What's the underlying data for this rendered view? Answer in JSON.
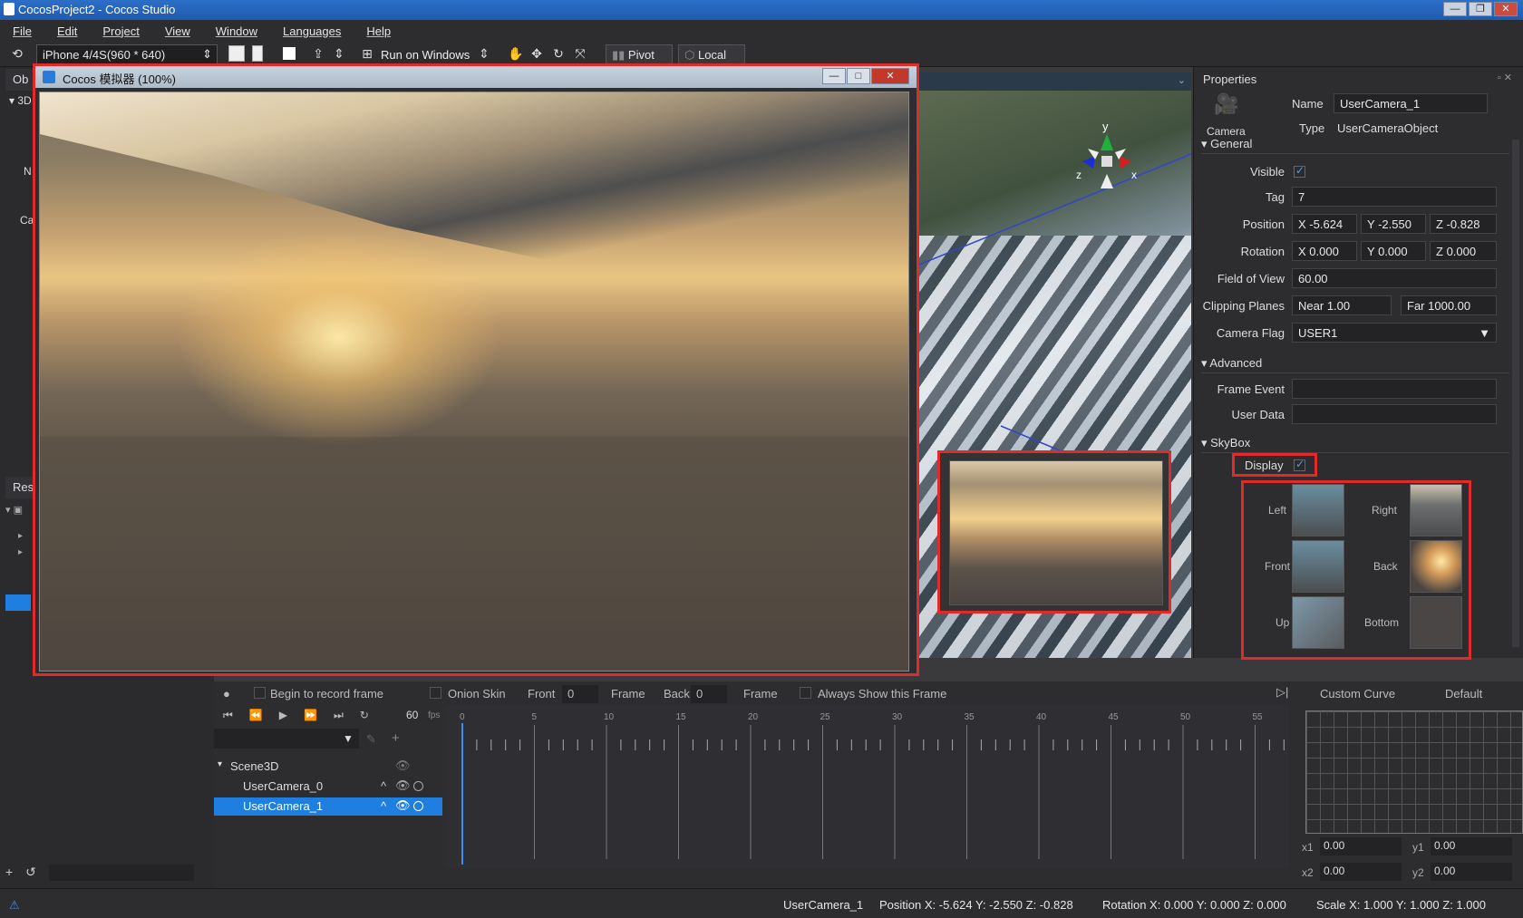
{
  "window": {
    "title": "CocosProject2 - Cocos Studio",
    "controls": [
      "—",
      "❐",
      "✕"
    ]
  },
  "menu": [
    "File",
    "Edit",
    "Project",
    "View",
    "Window",
    "Languages",
    "Help"
  ],
  "toolbar": {
    "device": "iPhone 4/4S(960 * 640)",
    "run_target": "Run on Windows",
    "pivot": "Pivot",
    "local": "Local"
  },
  "left": {
    "panel1_tab": "Ob",
    "tree_item": "3D",
    "n_label": "N",
    "ca_label": "Ca",
    "panel2_tab": "Res"
  },
  "simulator": {
    "title": "Cocos 模拟器 (100%)",
    "controls": [
      "—",
      "□",
      "✕"
    ]
  },
  "gizmo": {
    "y": "y",
    "x": "x",
    "z": "z"
  },
  "properties": {
    "header": "Properties",
    "icon_label": "Camera",
    "name_label": "Name",
    "name_value": "UserCamera_1",
    "type_label": "Type",
    "type_value": "UserCameraObject",
    "general": "General",
    "visible": "Visible",
    "tag_label": "Tag",
    "tag_value": "7",
    "position_label": "Position",
    "pos_x": "-5.624",
    "pos_y": "-2.550",
    "pos_z": "-0.828",
    "rotation_label": "Rotation",
    "rot_x": "0.000",
    "rot_y": "0.000",
    "rot_z": "0.000",
    "fov_label": "Field of View",
    "fov_value": "60.00",
    "clip_label": "Clipping Planes",
    "near_label": "Near",
    "near_value": "1.00",
    "far_label": "Far",
    "far_value": "1000.00",
    "flag_label": "Camera Flag",
    "flag_value": "USER1",
    "advanced": "Advanced",
    "frame_event": "Frame Event",
    "user_data": "User Data",
    "skybox": "SkyBox",
    "display": "Display",
    "faces": {
      "left": "Left",
      "right": "Right",
      "front": "Front",
      "back": "Back",
      "up": "Up",
      "bottom": "Bottom"
    },
    "axis_x": "X",
    "axis_y": "Y",
    "axis_z": "Z"
  },
  "timeline": {
    "record": "Begin to record frame",
    "onion": "Onion Skin",
    "front": "Front",
    "front_val": "0",
    "frame1": "Frame",
    "back": "Back",
    "back_val": "0",
    "frame2": "Frame",
    "always": "Always Show this Frame",
    "fps": "60",
    "fps_unit": "fps",
    "ticks": [
      "0",
      "5",
      "10",
      "15",
      "20",
      "25",
      "30",
      "35",
      "40",
      "45",
      "50",
      "55"
    ],
    "tree": [
      {
        "name": "Scene3D"
      },
      {
        "name": "UserCamera_0"
      },
      {
        "name": "UserCamera_1"
      }
    ]
  },
  "curve": {
    "title": "Custom Curve",
    "preset": "Default",
    "x1_label": "x1",
    "x1": "0.00",
    "y1_label": "y1",
    "y1": "0.00",
    "x2_label": "x2",
    "x2": "0.00",
    "y2_label": "y2",
    "y2": "0.00"
  },
  "status": {
    "object": "UserCamera_1",
    "position": "Position X: -5.624   Y: -2.550   Z: -0.828",
    "rotation": "Rotation X: 0.000   Y: 0.000   Z: 0.000",
    "scale": "Scale X: 1.000   Y: 1.000   Z: 1.000"
  }
}
